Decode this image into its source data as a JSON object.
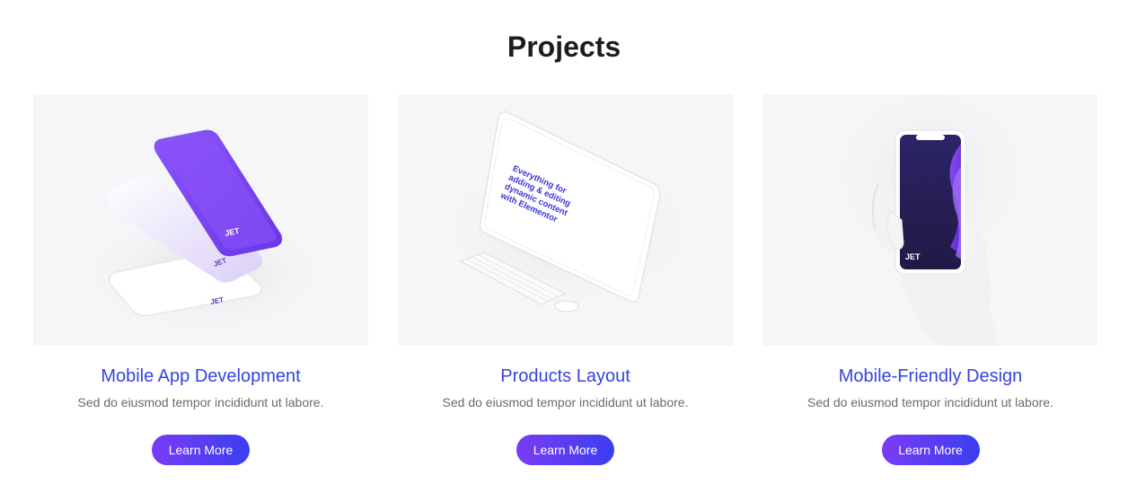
{
  "section": {
    "title": "Projects"
  },
  "cards": [
    {
      "title": "Mobile App Development",
      "text": "Sed do eiusmod tempor incididunt ut labore.",
      "button": "Learn More",
      "image": "phones-mockup"
    },
    {
      "title": "Products Layout",
      "text": "Sed do eiusmod tempor incididunt ut labore.",
      "button": "Learn More",
      "image": "tablet-keyboard-mockup",
      "screen_text": "Everything for adding & editing dynamic content with Elementor"
    },
    {
      "title": "Mobile-Friendly Design",
      "text": "Sed do eiusmod tempor incididunt ut labore.",
      "button": "Learn More",
      "image": "hand-phone-mockup"
    }
  ],
  "brand": {
    "logo_text": "JET",
    "logo_script": "Engine"
  },
  "colors": {
    "accent": "#3743e0",
    "button_start": "#7a3cf5",
    "button_end": "#3b3ef0",
    "media_bg": "#f5f6f7",
    "phone_purple": "#7b45f0"
  }
}
